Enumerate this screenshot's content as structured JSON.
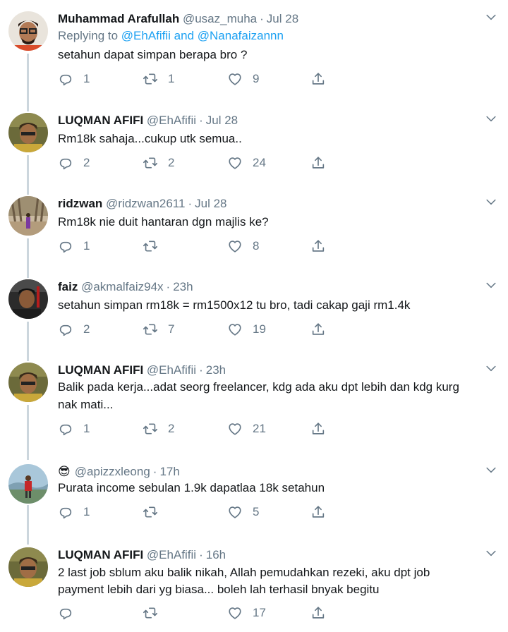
{
  "tweets": [
    {
      "name": "Muhammad Arafullah",
      "handle": "@usaz_muha",
      "time": "Jul 28",
      "replying_prefix": "Replying to",
      "replying_links": "@EhAfifii and @Nanafaizannn",
      "text": "setahun dapat simpan berapa bro ?",
      "replies": "1",
      "retweets": "1",
      "likes": "9"
    },
    {
      "name": "LUQMAN AFIFI",
      "handle": "@EhAfifii",
      "time": "Jul 28",
      "text": "Rm18k sahaja...cukup utk semua..",
      "replies": "2",
      "retweets": "2",
      "likes": "24"
    },
    {
      "name": "ridzwan",
      "handle": "@ridzwan2611",
      "time": "Jul 28",
      "text": "Rm18k nie duit hantaran dgn majlis ke?",
      "replies": "1",
      "retweets": "",
      "likes": "8"
    },
    {
      "name": "faiz",
      "handle": "@akmalfaiz94x",
      "time": "23h",
      "text": "setahun simpan rm18k = rm1500x12 tu bro, tadi cakap gaji rm1.4k",
      "replies": "2",
      "retweets": "7",
      "likes": "19"
    },
    {
      "name": "LUQMAN AFIFI",
      "handle": "@EhAfifii",
      "time": "23h",
      "text_line1": "Balik pada kerja...adat seorg freelancer, kdg ada aku dpt lebih dan kdg kurg",
      "text_line2": "nak mati...",
      "replies": "1",
      "retweets": "2",
      "likes": "21"
    },
    {
      "name_emoji": "😎",
      "handle": "@apizzxleong",
      "time": "17h",
      "text": "Purata income sebulan 1.9k dapatlaa 18k setahun",
      "replies": "1",
      "retweets": "",
      "likes": "5"
    },
    {
      "name": "LUQMAN AFIFI",
      "handle": "@EhAfifii",
      "time": "16h",
      "text_line1": "2 last job sblum aku balik nikah, Allah pemudahkan rezeki, aku dpt job",
      "text_line2": "payment lebih dari yg biasa... boleh lah terhasil bnyak begitu",
      "replies": "",
      "retweets": "",
      "likes": "17"
    }
  ],
  "icons": {
    "reply": "reply-icon",
    "retweet": "retweet-icon",
    "like": "heart-icon",
    "share": "share-icon",
    "caret": "chevron-down-icon"
  },
  "colors": {
    "text": "#14171a",
    "muted": "#657786",
    "link": "#1da1f2",
    "thread_line": "#ccd6dd"
  }
}
